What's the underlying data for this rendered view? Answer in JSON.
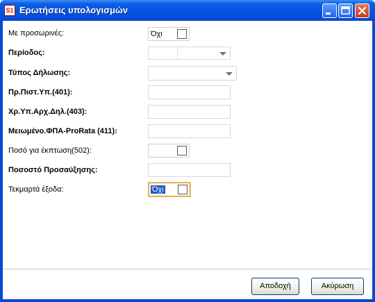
{
  "window": {
    "title": "Ερωτήσεις υπολογισμών",
    "icon": "s1-app-icon"
  },
  "controls": {
    "minimize": "minimize-icon",
    "maximize": "maximize-icon",
    "close": "close-icon"
  },
  "form": {
    "temporary": {
      "label": "Με προσωρινές:",
      "value": "Όχι"
    },
    "period": {
      "label": "Περίοδος:",
      "value": ""
    },
    "declaration_type": {
      "label": "Τύπος Δήλωσης:",
      "value": ""
    },
    "credit_401": {
      "label": "Πρ.Πιστ.Υπ.(401):",
      "value": ""
    },
    "debit_403": {
      "label": "Χρ.Υπ.Αρχ.Δηλ.(403):",
      "value": ""
    },
    "prorata_411": {
      "label": "Μειωμένο.ΦΠΑ-ProRata (411):",
      "value": ""
    },
    "deduct_502": {
      "label": "Ποσό για έκπτωση(502):",
      "value": ""
    },
    "surcharge": {
      "label": "Ποσοστό Προσαύξησης:",
      "value": ""
    },
    "presumptive": {
      "label": "Τεκμαρτά έξοδα:",
      "value": "Όχι"
    }
  },
  "buttons": {
    "ok": "Αποδοχή",
    "cancel": "Ακύρωση"
  },
  "colors": {
    "titlebar": "#0554e0",
    "frame": "#0a47d6",
    "focus_border": "#d89a28",
    "selection": "#2157c8"
  }
}
